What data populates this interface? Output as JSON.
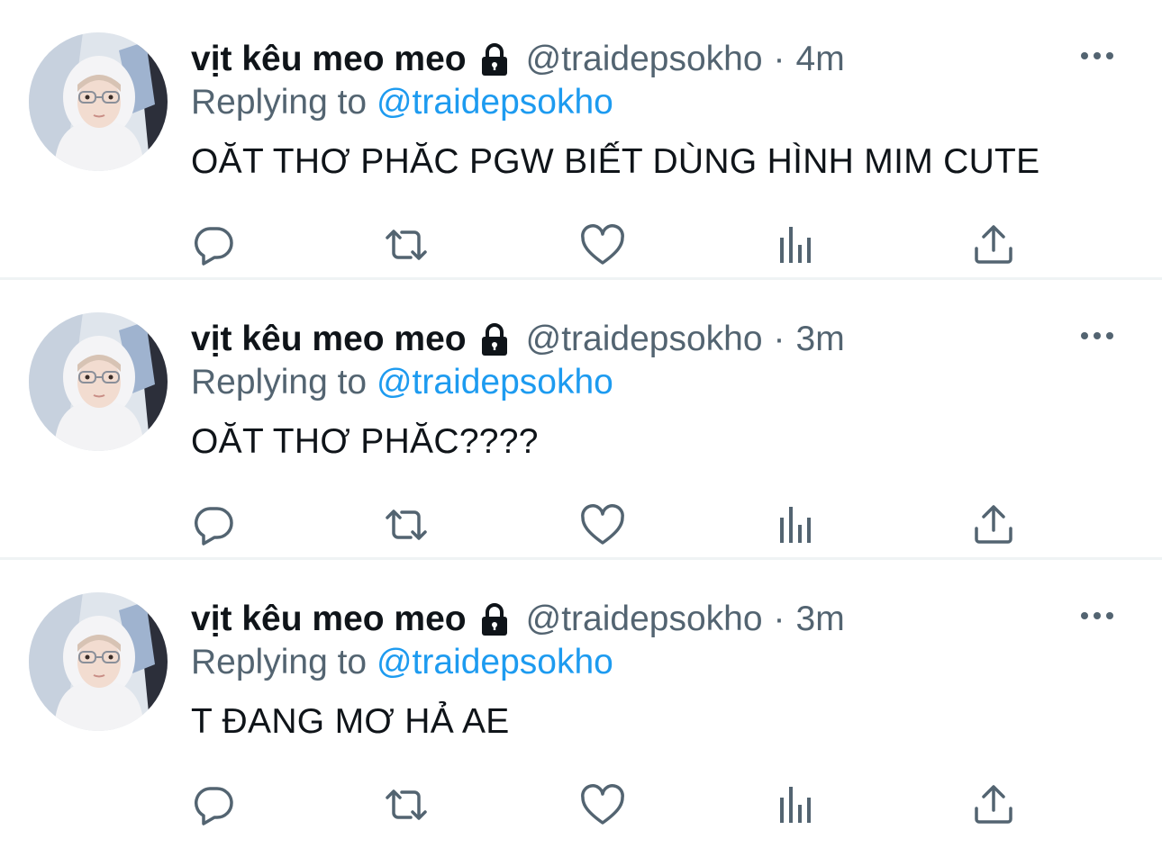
{
  "tweets": [
    {
      "display_name": "vịt kêu meo meo",
      "handle": "@traidepsokho",
      "separator": "·",
      "time": "4m",
      "replying_prefix": "Replying to",
      "replying_to": "@traidepsokho",
      "text": "OĂT THƠ PHĂC PGW BIẾT DÙNG HÌNH MIM CUTE"
    },
    {
      "display_name": "vịt kêu meo meo",
      "handle": "@traidepsokho",
      "separator": "·",
      "time": "3m",
      "replying_prefix": "Replying to",
      "replying_to": "@traidepsokho",
      "text": "OĂT THƠ PHĂC????"
    },
    {
      "display_name": "vịt kêu meo meo",
      "handle": "@traidepsokho",
      "separator": "·",
      "time": "3m",
      "replying_prefix": "Replying to",
      "replying_to": "@traidepsokho",
      "text": "T ĐANG MƠ HẢ AE"
    }
  ],
  "icons": {
    "protected": "lock-icon",
    "more": "more-icon",
    "reply": "reply-icon",
    "retweet": "retweet-icon",
    "like": "heart-icon",
    "analytics": "analytics-icon",
    "share": "share-icon"
  },
  "colors": {
    "text_primary": "#0f1419",
    "text_secondary": "#536471",
    "link": "#1d9bf0",
    "divider": "#eff3f4"
  }
}
